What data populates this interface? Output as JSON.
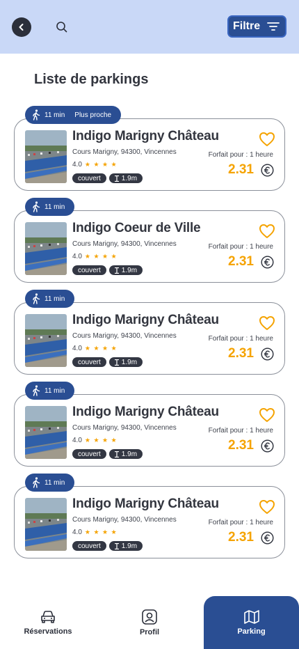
{
  "header": {
    "filter_label": "Filtre",
    "back_icon": "chevron-left-icon",
    "search_icon": "search-icon",
    "filter_icon": "filter-lines-icon"
  },
  "page_title": "Liste de parkings",
  "parkings": [
    {
      "walk_time": "11 min",
      "walk_extra": "Plus proche",
      "name": "Indigo Marigny Château",
      "address": "Cours Marigny, 94300, Vincennes",
      "rating": "4.0",
      "stars": "★ ★ ★ ★",
      "tag_covered": "couvert",
      "tag_height": "1.9m",
      "forfait": "Forfait pour : 1 heure",
      "price": "2.31"
    },
    {
      "walk_time": "11 min",
      "walk_extra": "",
      "name": "Indigo Coeur de Ville",
      "address": "Cours Marigny, 94300, Vincennes",
      "rating": "4.0",
      "stars": "★ ★ ★ ★",
      "tag_covered": "couvert",
      "tag_height": "1.9m",
      "forfait": "Forfait pour : 1 heure",
      "price": "2.31"
    },
    {
      "walk_time": "11 min",
      "walk_extra": "",
      "name": "Indigo Marigny Château",
      "address": "Cours Marigny, 94300, Vincennes",
      "rating": "4.0",
      "stars": "★ ★ ★ ★",
      "tag_covered": "couvert",
      "tag_height": "1.9m",
      "forfait": "Forfait pour : 1 heure",
      "price": "2.31"
    },
    {
      "walk_time": "11 min",
      "walk_extra": "",
      "name": "Indigo Marigny Château",
      "address": "Cours Marigny, 94300, Vincennes",
      "rating": "4.0",
      "stars": "★ ★ ★ ★",
      "tag_covered": "couvert",
      "tag_height": "1.9m",
      "forfait": "Forfait pour : 1 heure",
      "price": "2.31"
    },
    {
      "walk_time": "11 min",
      "walk_extra": "",
      "name": "Indigo Marigny Château",
      "address": "Cours Marigny, 94300, Vincennes",
      "rating": "4.0",
      "stars": "★ ★ ★ ★",
      "tag_covered": "couvert",
      "tag_height": "1.9m",
      "forfait": "Forfait pour : 1 heure",
      "price": "2.31"
    }
  ],
  "bottom_nav": {
    "reservations": "Réservations",
    "profil": "Profil",
    "parking": "Parking"
  },
  "colors": {
    "header_bg": "#c9d8f7",
    "primary": "#2a4e93",
    "accent": "#f5a300",
    "dark": "#2b2f3a"
  }
}
